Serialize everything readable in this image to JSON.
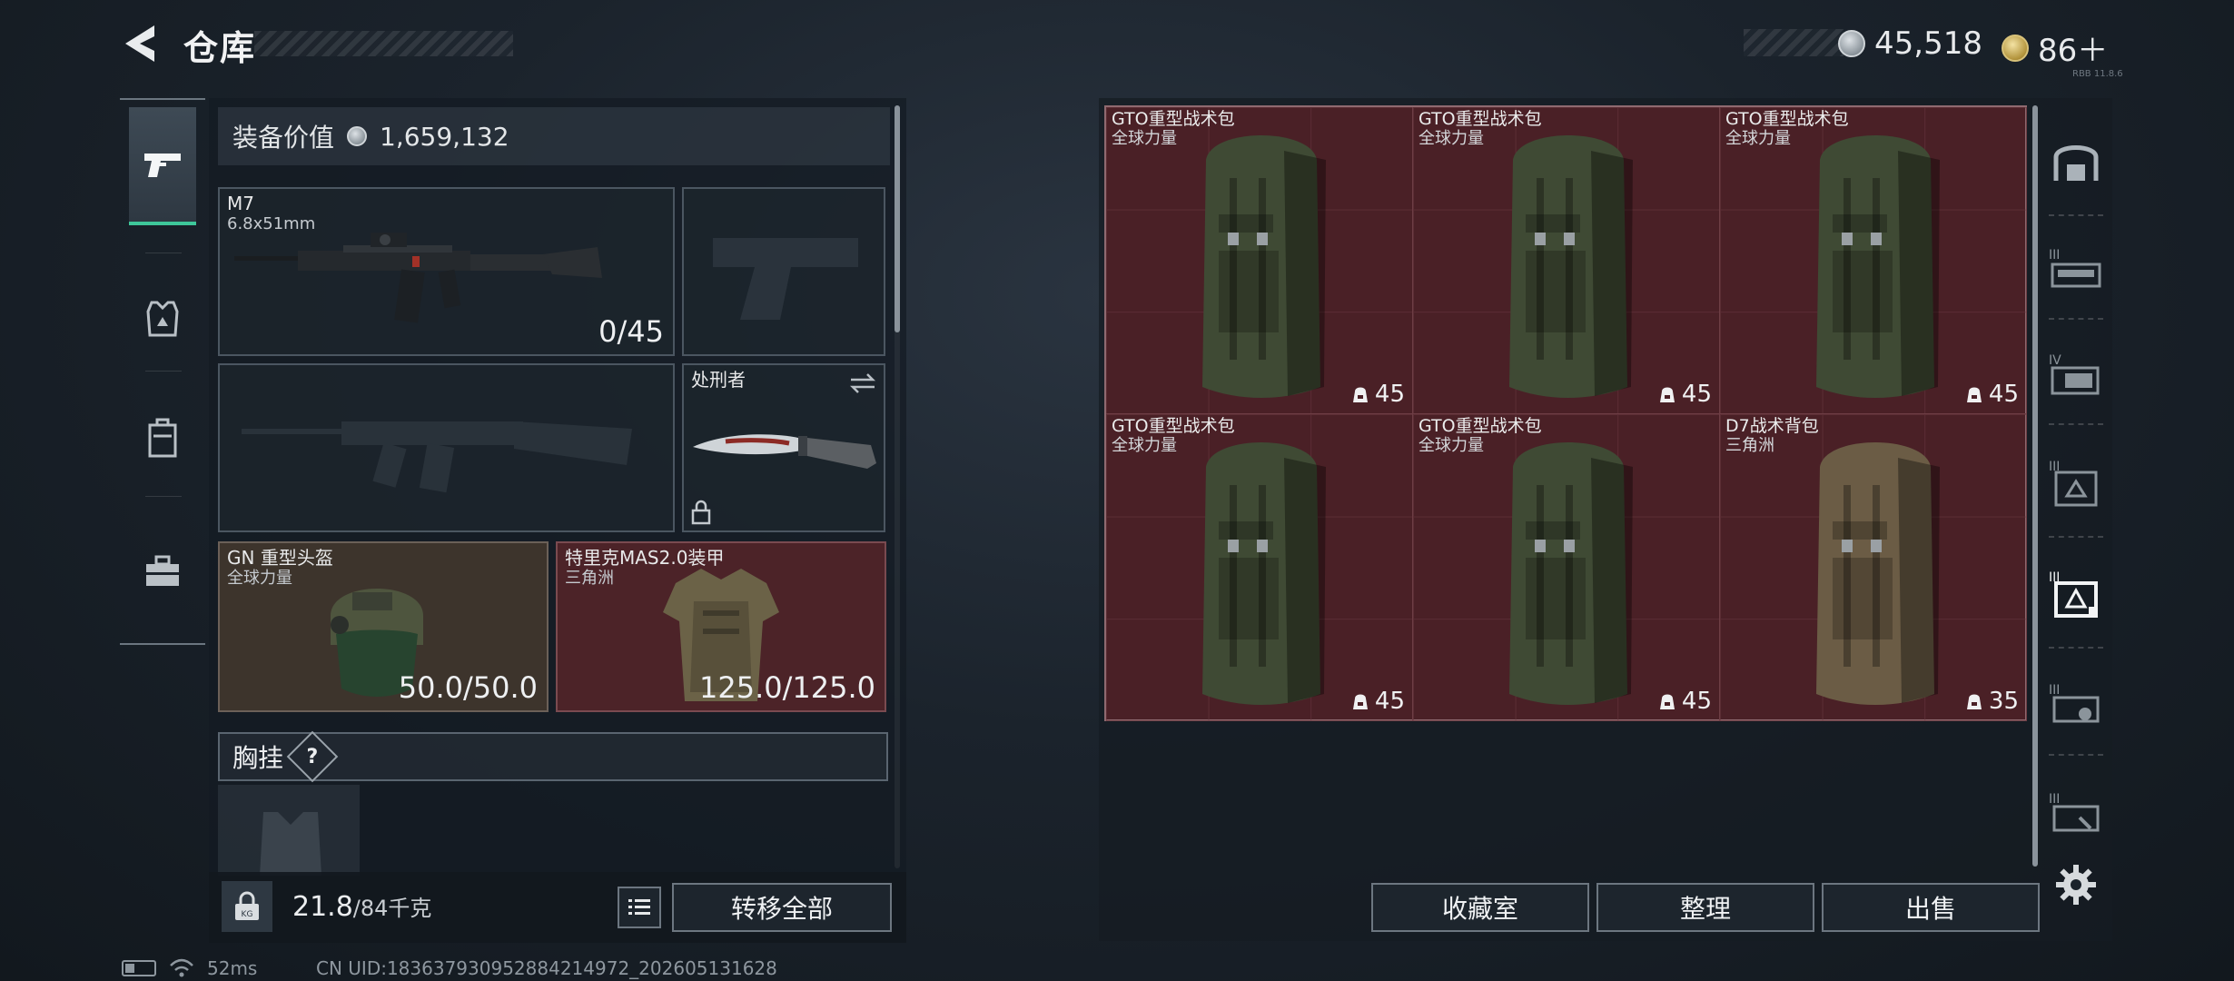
{
  "header": {
    "title": "仓库",
    "currency_silver": "45,518",
    "currency_gold": "86＋",
    "version_text": "RBB 11.8.6"
  },
  "left_rail": {
    "items": [
      {
        "id": "weapons",
        "icon": "pistol-icon",
        "active": true
      },
      {
        "id": "armor",
        "icon": "armor-vest-icon",
        "active": false
      },
      {
        "id": "backpack",
        "icon": "backpack-icon",
        "active": false
      },
      {
        "id": "toolbox",
        "icon": "toolbox-icon",
        "active": false
      }
    ]
  },
  "equipment": {
    "value_label": "装备价值",
    "value": "1,659,132",
    "primary_weapon": {
      "name": "M7",
      "caliber": "6.8x51mm",
      "ammo": "0/45"
    },
    "melee": {
      "name": "处刑者"
    },
    "helmet": {
      "name": "GN 重型头盔",
      "source": "全球力量",
      "durability": "50.0/50.0"
    },
    "armor": {
      "name": "特里克MAS2.0装甲",
      "source": "三角洲",
      "durability": "125.0/125.0"
    },
    "chest_rig": {
      "label": "胸挂",
      "help": "?"
    },
    "weight": {
      "current": "21.8",
      "max": "/84千克"
    },
    "transfer_all": "转移全部"
  },
  "storage": {
    "items": [
      {
        "name": "GTO重型战术包",
        "source": "全球力量",
        "capacity": "45",
        "tint": "#3f4a34"
      },
      {
        "name": "GTO重型战术包",
        "source": "全球力量",
        "capacity": "45",
        "tint": "#3f4a34"
      },
      {
        "name": "GTO重型战术包",
        "source": "全球力量",
        "capacity": "45",
        "tint": "#3f4a34"
      },
      {
        "name": "GTO重型战术包",
        "source": "全球力量",
        "capacity": "45",
        "tint": "#3f4a34"
      },
      {
        "name": "GTO重型战术包",
        "source": "全球力量",
        "capacity": "45",
        "tint": "#3f4a34"
      },
      {
        "name": "D7战术背包",
        "source": "三角洲",
        "capacity": "35",
        "tint": "#6b5c45"
      }
    ],
    "buttons": {
      "collection": "收藏室",
      "organize": "整理",
      "sell": "出售"
    }
  },
  "right_rail": {
    "icons": [
      "storage-home-icon",
      "tier3-weapon-icon",
      "tier4-container-icon",
      "tier3-armor-icon",
      "tier3-armor-selected-icon",
      "tier3-gear-icon",
      "tier3-tools-icon",
      "settings-gear-icon"
    ]
  },
  "status": {
    "ping": "52ms",
    "uid": "CN UID:183637930952884214972_202605131628"
  },
  "colors": {
    "accent_green": "#3ec79a",
    "storage_bg": "#4a2026",
    "helmet_bg": "#3d342c",
    "armor_bg": "#4c2328"
  }
}
